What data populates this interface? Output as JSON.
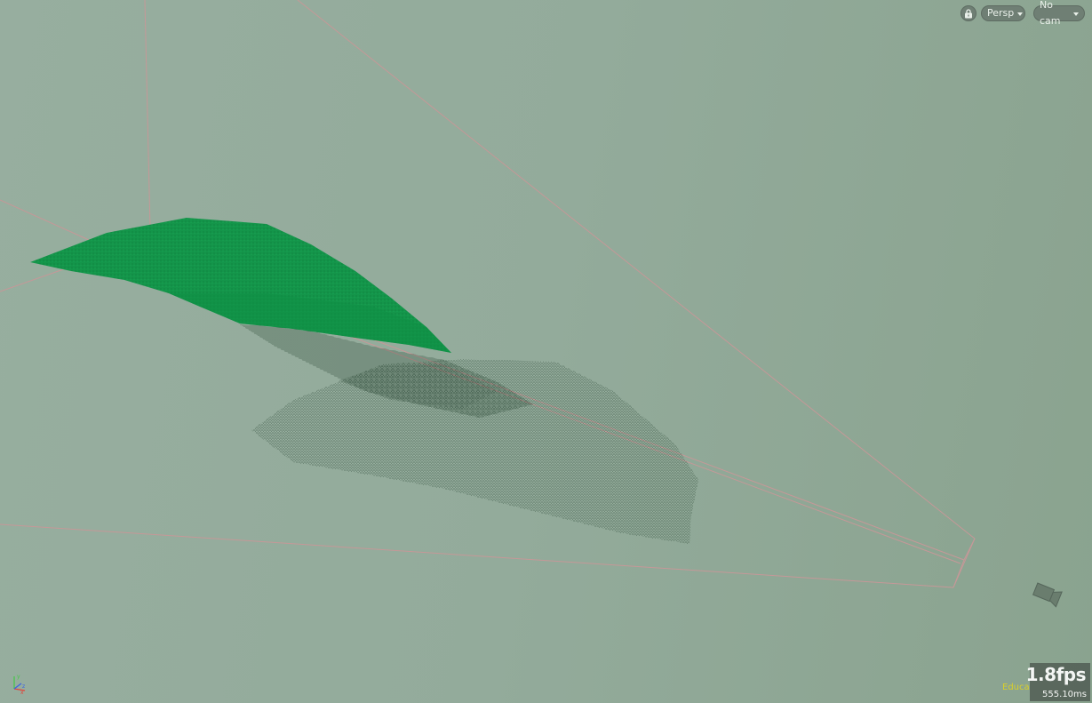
{
  "viewport": {
    "background_top": "#97ae9f",
    "background_bottom": "#8aa38f",
    "guide_line_color": "#c59898",
    "surface_color": "#0f8f45",
    "surface_dark_color": "#0d7f3c",
    "point_cloud_color": "#0b2a16"
  },
  "toolbar": {
    "lock_icon": "lock-icon",
    "view_mode": "Persp",
    "camera": "No cam"
  },
  "stats": {
    "fps": "1.8fps",
    "frame_time": "555.10ms"
  },
  "license_label": "Education",
  "axes": {
    "x_label": "x",
    "y_label": "y",
    "z_label": "z",
    "x_color": "#e0463c",
    "y_color": "#42c845",
    "z_color": "#3a62e6"
  },
  "camera_icon": "camera-object-icon"
}
